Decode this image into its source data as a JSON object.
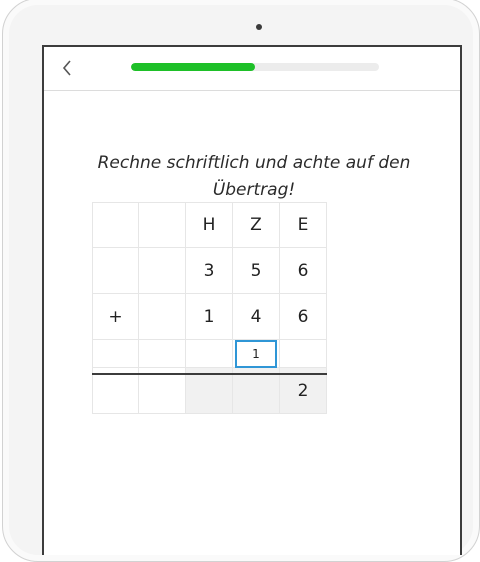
{
  "app": {
    "progress_percent": 50,
    "back_icon": "chevron-left-icon"
  },
  "task": {
    "instruction": "Rechne schriftlich und achte auf den Übertrag!"
  },
  "table": {
    "header": [
      "",
      "",
      "H",
      "Z",
      "E"
    ],
    "row1": [
      "",
      "",
      "3",
      "5",
      "6"
    ],
    "row2": [
      "+",
      "",
      "1",
      "4",
      "6"
    ],
    "carry": [
      "",
      "",
      "",
      "1",
      ""
    ],
    "result": [
      "",
      "",
      "",
      "",
      "2"
    ]
  },
  "colors": {
    "progress": "#1ec028",
    "input_focus": "#2f96d6"
  }
}
